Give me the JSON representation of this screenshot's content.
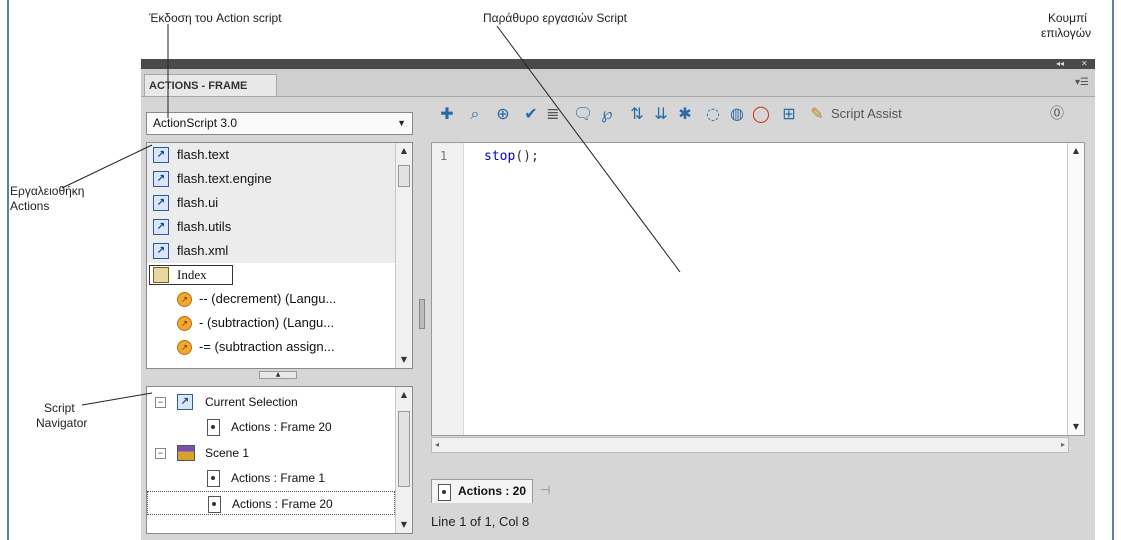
{
  "annotations": {
    "actionscript_version": "Έκδοση του Action script",
    "script_pane": "Παράθυρο εργασιών Script",
    "options_button_line1": "Κουμπί",
    "options_button_line2": "επιλογών",
    "actions_toolbox_line1": "Εργαλειοθήκη",
    "actions_toolbox_line2": "Actions",
    "script_navigator_line1": "Script",
    "script_navigator_line2": "Navigator"
  },
  "panel": {
    "tab_label": "ACTIONS - FRAME",
    "version_dropdown": "ActionScript 3.0",
    "toolbox_items": [
      {
        "label": "flash.text",
        "kind": "package"
      },
      {
        "label": "flash.text.engine",
        "kind": "package"
      },
      {
        "label": "flash.ui",
        "kind": "package"
      },
      {
        "label": "flash.utils",
        "kind": "package"
      },
      {
        "label": "flash.xml",
        "kind": "package"
      },
      {
        "label": "Index",
        "kind": "index"
      },
      {
        "label": "-- (decrement) (Langu...",
        "kind": "entry"
      },
      {
        "label": "- (subtraction) (Langu...",
        "kind": "entry"
      },
      {
        "label": "-= (subtraction assign...",
        "kind": "entry"
      }
    ],
    "navigator_items": [
      {
        "label": "Current Selection"
      },
      {
        "label": "Actions : Frame 20"
      },
      {
        "label": "Scene 1"
      },
      {
        "label": "Actions : Frame 1"
      },
      {
        "label": "Actions : Frame 20"
      }
    ],
    "script_assist_label": "Script Assist",
    "editor": {
      "line_number": "1",
      "code_keyword": "stop",
      "code_rest": "();"
    },
    "bottom_tab_label": "Actions : 20",
    "status_line": "Line 1 of 1, Col 8"
  },
  "colors": {
    "panel_bg": "#d6d6d6",
    "code_keyword": "#0000cc",
    "frame_border": "#5b7fb3"
  },
  "icons": [
    "add-statement-icon",
    "find-icon",
    "insert-target-path-icon",
    "check-syntax-icon",
    "auto-format-icon",
    "show-code-hint-icon",
    "debug-options-icon",
    "collapse-between-braces-icon",
    "collapse-selection-icon",
    "expand-all-icon",
    "apply-block-comment-icon",
    "apply-line-comment-icon",
    "remove-comment-icon",
    "show-hide-toolbox-icon",
    "script-assist-wand-icon",
    "help-icon"
  ]
}
